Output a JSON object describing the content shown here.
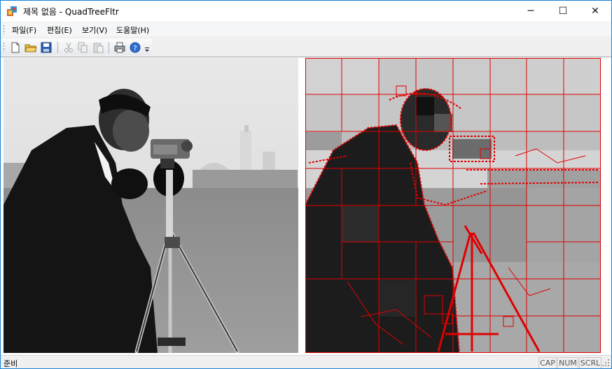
{
  "window": {
    "title": "제목 없음 - QuadTreeFltr",
    "controls": {
      "minimize": "─",
      "maximize": "☐",
      "close": "✕"
    }
  },
  "menubar": {
    "items": [
      {
        "label": "파일(F)"
      },
      {
        "label": "편집(E)"
      },
      {
        "label": "보기(V)"
      },
      {
        "label": "도움말(H)"
      }
    ]
  },
  "toolbar": {
    "buttons": [
      {
        "icon": "new-file-icon"
      },
      {
        "icon": "open-folder-icon"
      },
      {
        "icon": "save-icon"
      },
      {
        "icon": "cut-icon",
        "enabled": false
      },
      {
        "icon": "copy-icon",
        "enabled": false
      },
      {
        "icon": "paste-icon",
        "enabled": false
      },
      {
        "icon": "print-icon"
      },
      {
        "icon": "help-icon"
      },
      {
        "icon": "toolbar-overflow-icon"
      }
    ]
  },
  "panels": {
    "original": {
      "content": "grayscale photo of a cameraman with tripod"
    },
    "quadtree": {
      "content": "quadtree-segmented image with red cell borders",
      "border_color": "#e00000"
    }
  },
  "statusbar": {
    "text": "준비",
    "indicators": [
      "CAP",
      "NUM",
      "SCRL"
    ]
  },
  "colors": {
    "accent": "#1883d7",
    "quadtree_border": "#e00000"
  }
}
